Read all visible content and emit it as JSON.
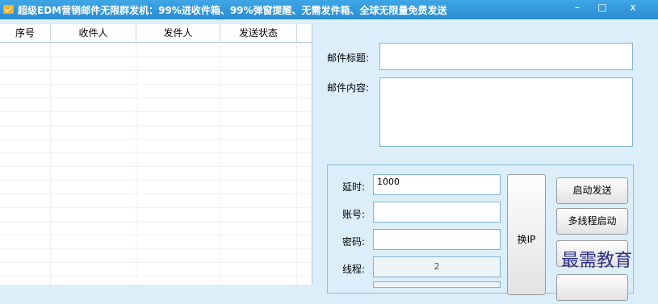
{
  "window": {
    "title": "超级EDM营销邮件无限群发机：99%进收件箱、99%弹窗提醒、无需发件箱、全球无限量免费发送",
    "min_icon": "minimize-icon",
    "max_icon": "maximize-icon",
    "close_icon": "close-icon",
    "min_glyph": "–",
    "max_glyph": "□",
    "close_glyph": "x"
  },
  "grid": {
    "columns": [
      "序号",
      "收件人",
      "发件人",
      "发送状态"
    ],
    "rows": []
  },
  "form": {
    "subject_label": "邮件标题:",
    "subject_value": "",
    "content_label": "邮件内容:",
    "content_value": ""
  },
  "settings": {
    "delay_label": "延时:",
    "delay_value": "1000",
    "account_label": "账号:",
    "account_value": "",
    "password_label": "密码:",
    "password_value": "",
    "threads_label": "线程:",
    "threads_value": "2"
  },
  "buttons": {
    "change_ip": "换IP",
    "start_send": "启动发送",
    "multi_thread": "多线程启动"
  },
  "watermark": "最需教育",
  "colors": {
    "titlebar": "#2a8bd3",
    "panel": "#dbeef9"
  }
}
